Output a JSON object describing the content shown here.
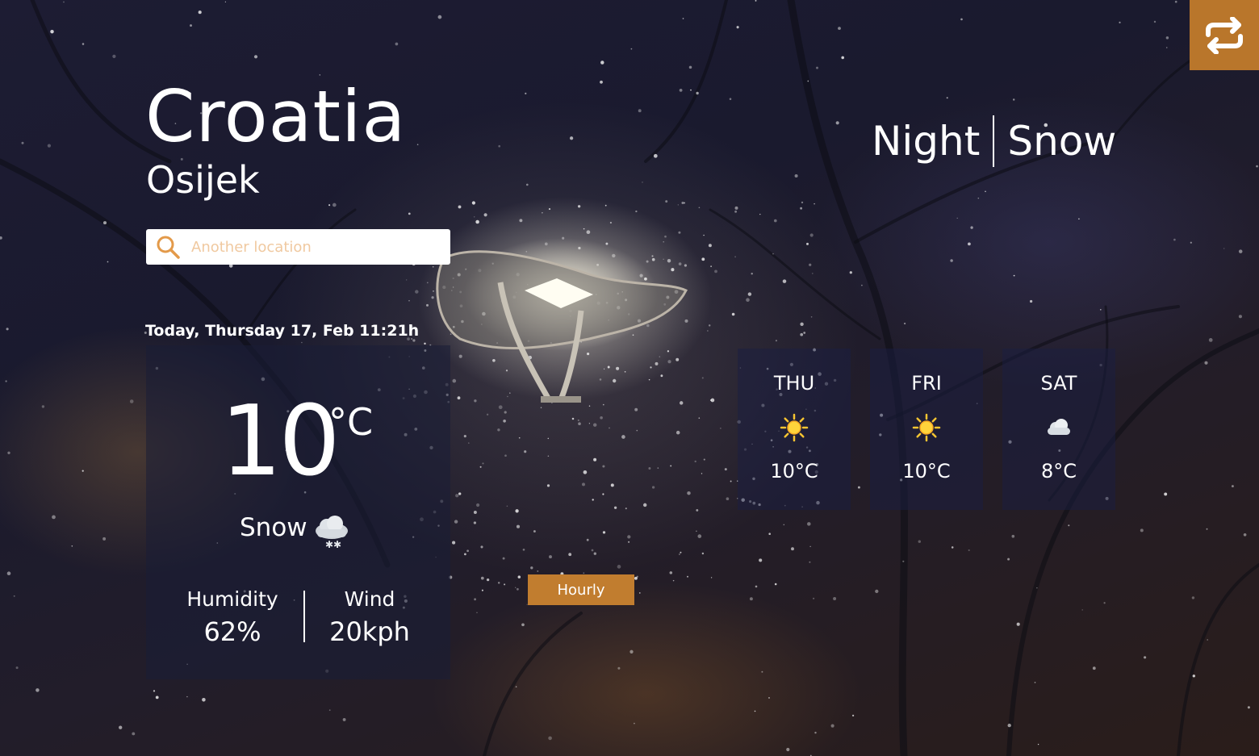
{
  "location": {
    "country": "Croatia",
    "city": "Osijek"
  },
  "search": {
    "placeholder": "Another location",
    "value": "",
    "icon": "search-icon"
  },
  "header": {
    "time_of_day": "Night",
    "condition": "Snow"
  },
  "current": {
    "date_text": "Today, Thursday 17, Feb 11:21h",
    "temperature": "10",
    "unit": "°C",
    "condition": "Snow",
    "condition_icon": "snow-cloud-icon",
    "humidity_label": "Humidity",
    "humidity_value": "62%",
    "wind_label": "Wind",
    "wind_value": "20kph"
  },
  "forecast": [
    {
      "day": "THU",
      "icon": "sun-icon",
      "temp": "10°C"
    },
    {
      "day": "FRI",
      "icon": "sun-icon",
      "temp": "10°C"
    },
    {
      "day": "SAT",
      "icon": "cloud-icon",
      "temp": "8°C"
    }
  ],
  "buttons": {
    "hourly": "Hourly",
    "swap_icon": "swap-arrows-icon"
  },
  "colors": {
    "accent": "#b9762b",
    "button": "#c17d2f",
    "search_icon": "#e39a4a",
    "sun": "#f7c531",
    "card": "#191e37"
  }
}
